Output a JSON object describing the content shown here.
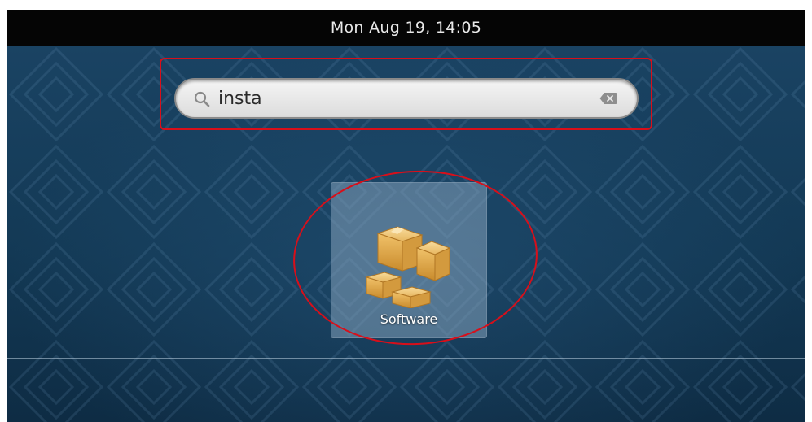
{
  "topbar": {
    "clock": "Mon Aug 19, 14:05"
  },
  "search": {
    "value": "insta",
    "icon": "search-icon",
    "clear_icon": "clear-icon"
  },
  "results": [
    {
      "label": "Software",
      "icon": "software-package-icon"
    }
  ],
  "colors": {
    "topbar_bg": "#050505",
    "desktop_bg": "#133955",
    "annotation_red": "#d80f1a",
    "tile_bg": "#84a0ba"
  }
}
